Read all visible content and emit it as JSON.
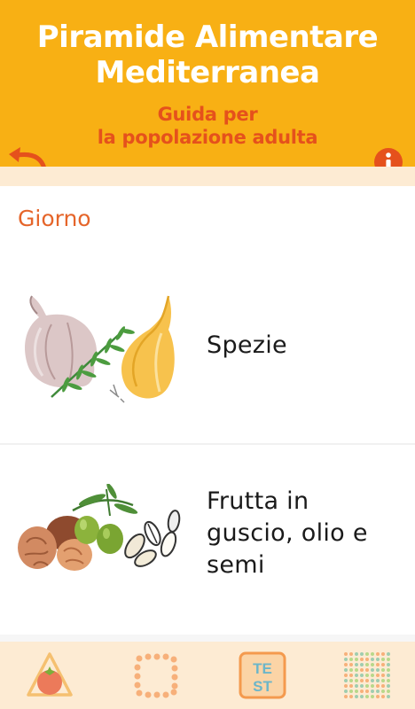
{
  "header": {
    "title_line1": "Piramide Alimentare",
    "title_line2": "Mediterranea",
    "subtitle_line1": "Guida per",
    "subtitle_line2": "la popolazione adulta"
  },
  "section": {
    "title": "Giorno"
  },
  "items": [
    {
      "label_lines": [
        "Spezie"
      ]
    },
    {
      "label_lines": [
        "Frutta in",
        "guscio, olio e",
        "semi"
      ]
    }
  ],
  "tabs": [
    {
      "icon": "pyramid-tomato-icon",
      "active": true
    },
    {
      "icon": "dotted-square-icon",
      "active": false
    },
    {
      "icon": "test-icon",
      "label_line1": "TE",
      "label_line2": "ST",
      "active": false
    },
    {
      "icon": "dot-grid-icon",
      "active": false
    }
  ],
  "colors": {
    "header": "#f8b014",
    "accent": "#e5511c",
    "strip": "#fdebd3",
    "section_title": "#e5652a"
  }
}
